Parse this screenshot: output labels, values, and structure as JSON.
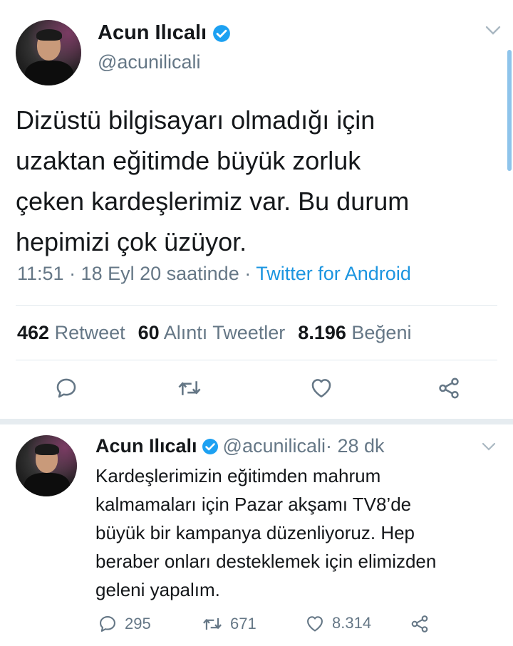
{
  "main_tweet": {
    "display_name": "Acun Ilıcalı",
    "handle": "@acunilicali",
    "text_lines": [
      "Dizüstü bilgisayarı olmadığı için",
      "uzaktan eğitimde büyük zorluk",
      "çeken kardeşlerimiz var. Bu durum",
      "hepimizi çok üzüyor."
    ],
    "time": "11:51 · 18 Eyl 20 saatinde · ",
    "source": "Twitter for Android",
    "stats": {
      "retweets_count": "462",
      "retweets_label": "Retweet",
      "quotes_count": "60",
      "quotes_label": "Alıntı Tweetler",
      "likes_count": "8.196",
      "likes_label": "Beğeni"
    },
    "icons": [
      "reply-icon",
      "retweet-icon",
      "like-icon",
      "share-icon"
    ]
  },
  "reply_tweet": {
    "display_name": "Acun Ilıcalı",
    "handle": "@acunilicali",
    "time_ago": " · 28 dk",
    "text_lines": [
      "Kardeşlerimizin eğitimden mahrum",
      "kalmamaları için Pazar akşamı TV8’de",
      "büyük bir kampanya düzenliyoruz. Hep",
      "beraber onları desteklemek için elimizden",
      "geleni yapalım."
    ],
    "reply_count": "295",
    "retweet_count": "671",
    "like_count": "8.314"
  },
  "colors": {
    "accent": "#1b95e0",
    "verified": "#1da1f2",
    "secondary_text": "#657786",
    "divider": "#e1e8ed"
  }
}
